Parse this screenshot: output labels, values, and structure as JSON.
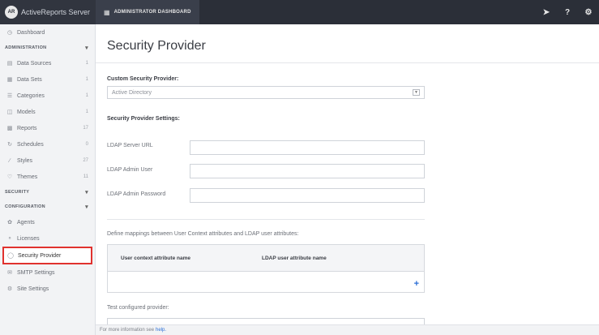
{
  "app": {
    "brand_title": "ActiveReports Server",
    "logo_text": "AR"
  },
  "topbar": {
    "dashboard_tab": "ADMINISTRATOR DASHBOARD",
    "icons": [
      "logout-icon",
      "help-icon",
      "settings-icon"
    ],
    "help_glyph": "?"
  },
  "sidebar": {
    "dashboard": "Dashboard",
    "administration": "ADMINISTRATION",
    "admin_items": [
      {
        "label": "Data Sources",
        "count": "1",
        "icon": "data-sources-icon"
      },
      {
        "label": "Data Sets",
        "count": "1",
        "icon": "data-sets-icon"
      },
      {
        "label": "Categories",
        "count": "1",
        "icon": "categories-icon"
      },
      {
        "label": "Models",
        "count": "1",
        "icon": "models-icon"
      },
      {
        "label": "Reports",
        "count": "17",
        "icon": "reports-icon"
      },
      {
        "label": "Schedules",
        "count": "0",
        "icon": "schedules-icon"
      },
      {
        "label": "Styles",
        "count": "27",
        "icon": "styles-icon"
      },
      {
        "label": "Themes",
        "count": "11",
        "icon": "themes-icon"
      }
    ],
    "security": "SECURITY",
    "configuration": "CONFIGURATION",
    "config_items": [
      {
        "label": "Agents",
        "icon": "agents-icon"
      },
      {
        "label": "Licenses",
        "icon": "licenses-icon"
      },
      {
        "label": "Security Provider",
        "icon": "security-provider-icon",
        "active": true
      },
      {
        "label": "SMTP Settings",
        "icon": "smtp-icon"
      },
      {
        "label": "Site Settings",
        "icon": "site-settings-icon"
      }
    ]
  },
  "main": {
    "title": "Security Provider",
    "custom_provider_label": "Custom Security Provider:",
    "custom_provider_value": "Active Directory",
    "settings_label": "Security Provider Settings:",
    "fields": {
      "ldap_url": "LDAP Server URL",
      "ldap_user": "LDAP Admin User",
      "ldap_password": "LDAP Admin Password"
    },
    "mapping_description": "Define mappings between User Context attributes and LDAP user attributes:",
    "mapping_columns": [
      "User context attribute name",
      "LDAP user attribute name"
    ],
    "add_glyph": "+",
    "test_label": "Test configured provider:"
  },
  "footer": {
    "text": "For more information see",
    "link": "help."
  },
  "colors": {
    "topbar": "#2b2f38",
    "active_border": "#e0322e",
    "link": "#2c6fd6"
  }
}
